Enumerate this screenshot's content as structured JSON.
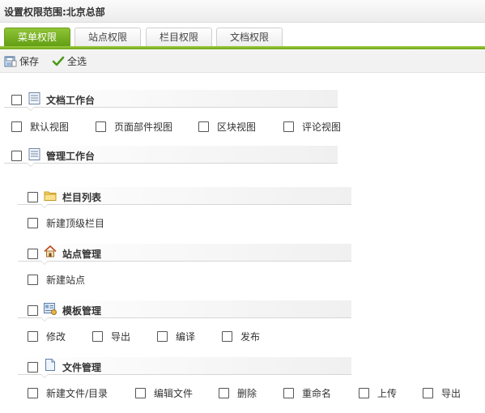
{
  "title": "设置权限范围:北京总部",
  "tabs": [
    {
      "label": "菜单权限",
      "active": true
    },
    {
      "label": "站点权限",
      "active": false
    },
    {
      "label": "栏目权限",
      "active": false
    },
    {
      "label": "文档权限",
      "active": false
    }
  ],
  "toolbar": {
    "save_label": "保存",
    "select_all_label": "全选"
  },
  "sections": [
    {
      "title": "文档工作台",
      "icon": "document-list-icon",
      "items": [
        "默认视图",
        "页面部件视图",
        "区块视图",
        "评论视图"
      ]
    },
    {
      "title": "管理工作台",
      "icon": "document-list-icon",
      "subgroups": [
        {
          "title": "栏目列表",
          "icon": "folder-icon",
          "items": [
            "新建顶级栏目"
          ]
        },
        {
          "title": "站点管理",
          "icon": "home-icon",
          "items": [
            "新建站点"
          ]
        },
        {
          "title": "模板管理",
          "icon": "template-icon",
          "items": [
            "修改",
            "导出",
            "编译",
            "发布"
          ]
        },
        {
          "title": "文件管理",
          "icon": "file-icon",
          "items": [
            "新建文件/目录",
            "编辑文件",
            "删除",
            "重命名",
            "上传",
            "导出"
          ]
        }
      ]
    }
  ],
  "colors": {
    "accent": "#6fa61c",
    "tab_active": "#7ab32a"
  }
}
